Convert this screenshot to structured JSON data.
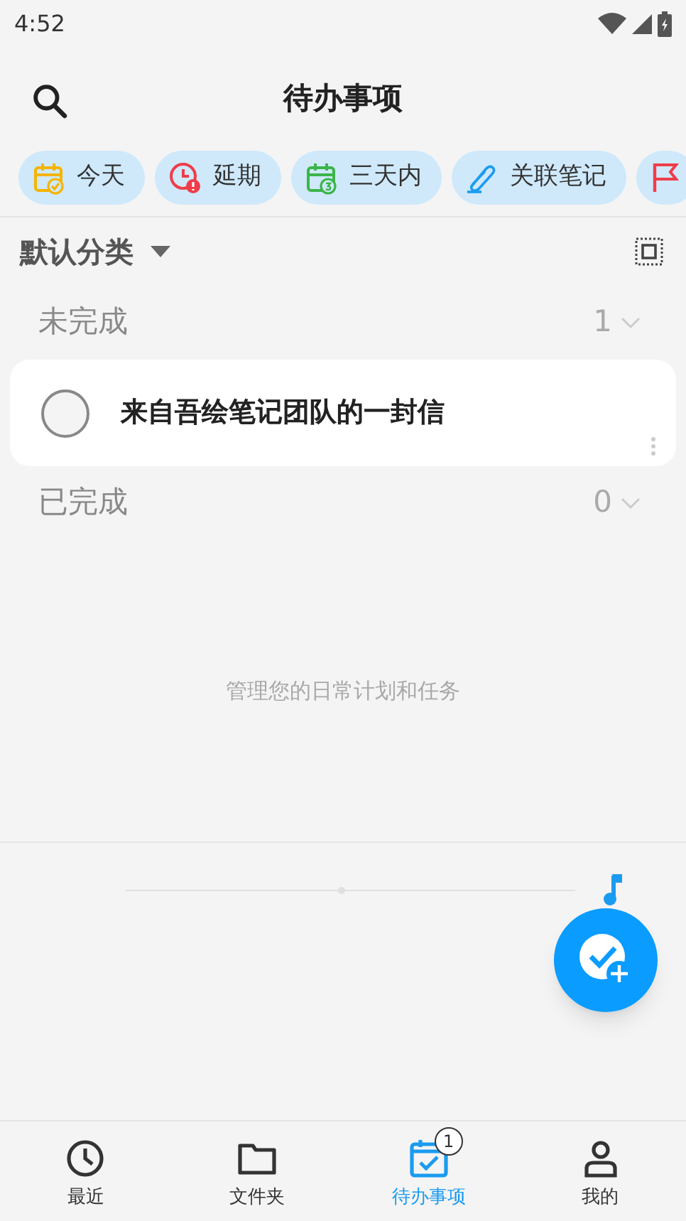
{
  "status_bar": {
    "time": "4:52"
  },
  "header": {
    "title": "待办事项"
  },
  "filters": [
    {
      "kind": "today",
      "label": "今天"
    },
    {
      "kind": "overdue",
      "label": "延期"
    },
    {
      "kind": "three_days",
      "label": "三天内"
    },
    {
      "kind": "linked_notes",
      "label": "关联笔记"
    },
    {
      "kind": "flag"
    }
  ],
  "category": {
    "label": "默认分类"
  },
  "groups": [
    {
      "title": "未完成",
      "count": "1",
      "tasks": [
        {
          "title": "来自吾绘笔记团队的一封信",
          "checked": false
        }
      ]
    },
    {
      "title": "已完成",
      "count": "0"
    }
  ],
  "empty_hint": "管理您的日常计划和任务",
  "player": {
    "level": 0.48
  },
  "bottom_nav": [
    {
      "kind": "recent",
      "label": "最近",
      "selected": false
    },
    {
      "kind": "folder",
      "label": "文件夹",
      "selected": false
    },
    {
      "kind": "todo",
      "label": "待办事项",
      "selected": true,
      "badge": "1"
    },
    {
      "kind": "me",
      "label": "我的",
      "selected": false
    }
  ]
}
